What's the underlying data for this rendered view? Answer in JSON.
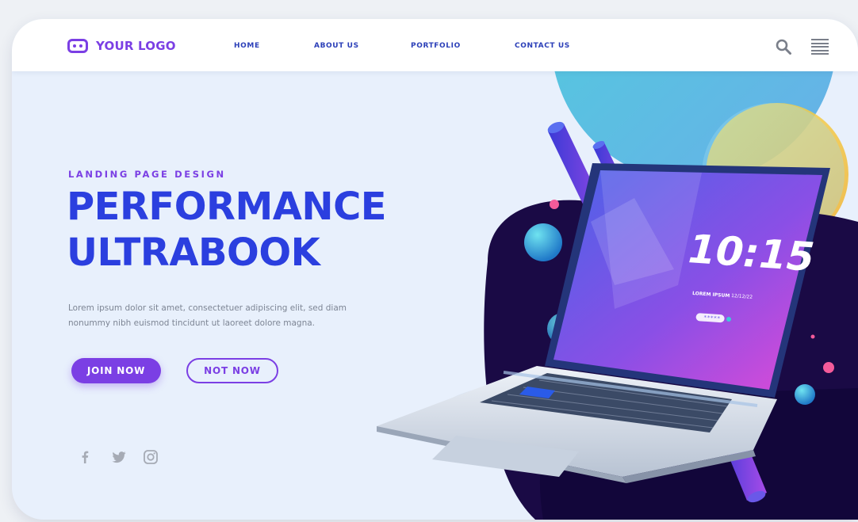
{
  "brand": {
    "name": "YOUR LOGO",
    "icon": "robot-face-icon",
    "accent": "#7b3fe4",
    "heading_color": "#2b3fdf"
  },
  "nav": {
    "items": [
      {
        "label": "HOME"
      },
      {
        "label": "ABOUT US"
      },
      {
        "label": "PORTFOLIO"
      },
      {
        "label": "CONTACT US"
      }
    ],
    "icons": [
      "search-icon",
      "menu-icon"
    ]
  },
  "hero": {
    "eyebrow": "LANDING PAGE DESIGN",
    "title_line1": "PERFORMANCE",
    "title_line2": "ULTRABOOK",
    "description": "Lorem ipsum dolor sit amet, consectetuer adipiscing elit, sed diam nonummy nibh euismod tincidunt ut laoreet dolore magna.",
    "primary_button": "JOIN NOW",
    "secondary_button": "NOT NOW"
  },
  "social": [
    "facebook-icon",
    "twitter-icon",
    "instagram-icon"
  ],
  "laptop_screen": {
    "time": "10:15",
    "caption": "LOREM IPSUM",
    "date": "12/12/22",
    "password_mask": "*****"
  }
}
